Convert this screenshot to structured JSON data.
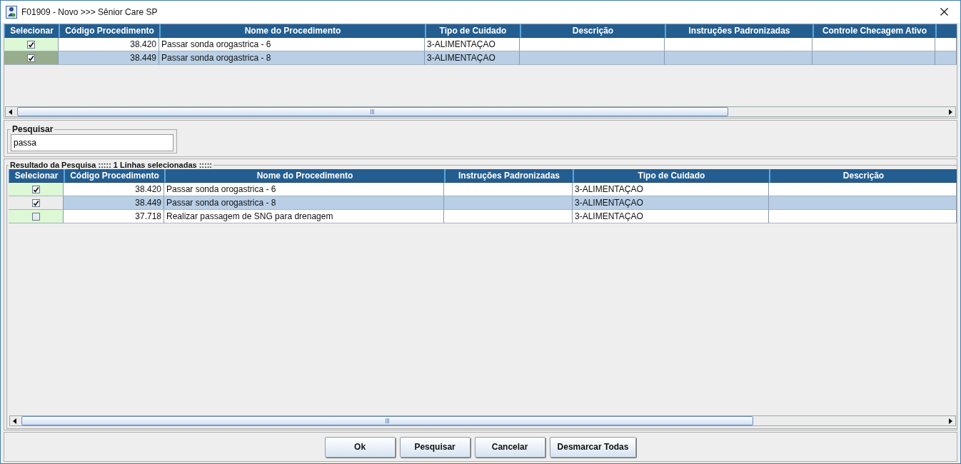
{
  "window": {
    "title": "F01909 - Novo >>> Sênior Care SP"
  },
  "selected_table": {
    "columns": [
      "Selecionar",
      "Código Procedimento",
      "Nome do Procedimento",
      "Tipo de Cuidado",
      "Descrição",
      "Instruções Padronizadas",
      "Controle Checagem Ativo"
    ],
    "rows": [
      {
        "checked": true,
        "selected": false,
        "code": "38.420",
        "name": "Passar sonda orogastrica - 6",
        "care_type": "3-ALIMENTAÇAO"
      },
      {
        "checked": true,
        "selected": true,
        "code": "38.449",
        "name": "Passar sonda orogastrica - 8",
        "care_type": "3-ALIMENTAÇAO"
      }
    ]
  },
  "search": {
    "label": "Pesquisar",
    "value": "passa"
  },
  "results": {
    "title": "Resultado da Pesquisa ::::: 1 Linhas selecionadas :::::",
    "columns": [
      "Selecionar",
      "Código Procedimento",
      "Nome do Procedimento",
      "Instruções Padronizadas",
      "Tipo de Cuidado",
      "Descrição"
    ],
    "rows": [
      {
        "checked": true,
        "selected": false,
        "code": "38.420",
        "name": "Passar sonda orogastrica - 6",
        "care_type": "3-ALIMENTAÇAO"
      },
      {
        "checked": true,
        "selected": true,
        "code": "38.449",
        "name": "Passar sonda orogastrica - 8",
        "care_type": "3-ALIMENTAÇAO"
      },
      {
        "checked": false,
        "selected": false,
        "code": "37.718",
        "name": "Realizar passagem de SNG para drenagem",
        "care_type": "3-ALIMENTAÇAO"
      }
    ]
  },
  "buttons": [
    "Ok",
    "Pesquisar",
    "Cancelar",
    "Desmarcar Todas"
  ]
}
